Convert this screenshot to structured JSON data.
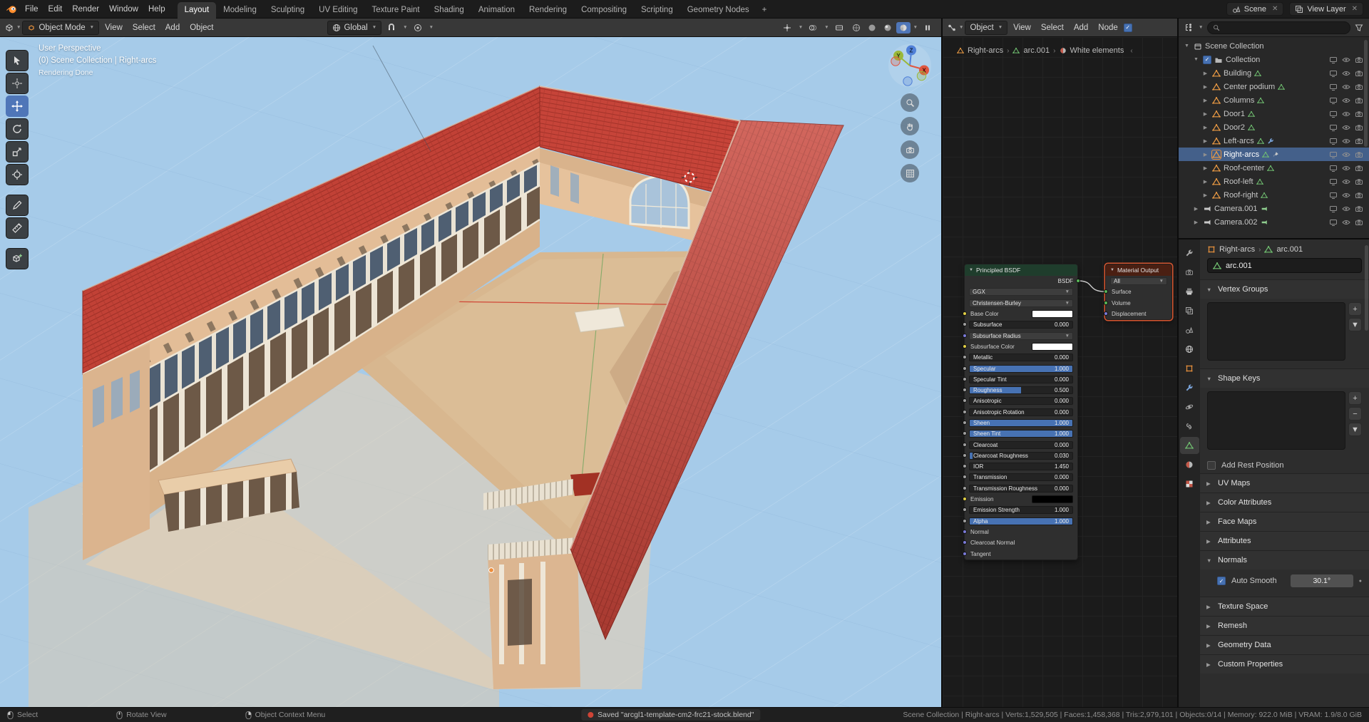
{
  "topbar": {
    "menus": [
      "File",
      "Edit",
      "Render",
      "Window",
      "Help"
    ],
    "workspaces": [
      "Layout",
      "Modeling",
      "Sculpting",
      "UV Editing",
      "Texture Paint",
      "Shading",
      "Animation",
      "Rendering",
      "Compositing",
      "Scripting",
      "Geometry Nodes"
    ],
    "active_workspace": "Layout",
    "add_workspace_label": "+",
    "scene_label": "Scene",
    "view_layer_label": "View Layer"
  },
  "viewport": {
    "header": {
      "mode": "Object Mode",
      "menus": [
        "View",
        "Select",
        "Add",
        "Object"
      ],
      "orientation": "Global"
    },
    "overlay": [
      "User Perspective",
      "(0) Scene Collection | Right-arcs",
      "Rendering Done"
    ],
    "gizmo_axes": [
      "X",
      "Y",
      "Z"
    ],
    "tools": [
      {
        "name": "select-box",
        "icon": "t_select",
        "active": false
      },
      {
        "name": "cursor",
        "icon": "t_cursor",
        "active": false
      },
      {
        "name": "move",
        "icon": "t_move",
        "active": true
      },
      {
        "name": "rotate",
        "icon": "t_rotate",
        "active": false
      },
      {
        "name": "scale",
        "icon": "t_scale",
        "active": false
      },
      {
        "name": "transform",
        "icon": "t_transform",
        "active": false
      },
      {
        "name": "annotate",
        "icon": "t_annotate",
        "active": false,
        "gap": true
      },
      {
        "name": "measure",
        "icon": "t_measure",
        "active": false
      },
      {
        "name": "add-cube",
        "icon": "t_addcube",
        "active": false,
        "gap": true
      }
    ]
  },
  "shader_editor": {
    "header": {
      "type": "Object",
      "menus": [
        "View",
        "Select",
        "Add",
        "Node"
      ]
    },
    "breadcrumb": [
      "Right-arcs",
      "arc.001",
      "White elements"
    ],
    "back_arrow": "‹",
    "principled": {
      "title": "Principled BSDF",
      "output_label": "BSDF",
      "dropdowns": [
        "GGX",
        "Christensen-Burley"
      ],
      "rows": [
        {
          "t": "color",
          "label": "Base Color",
          "swatch": "#ffffff",
          "socket": "yellow"
        },
        {
          "t": "slider",
          "label": "Subsurface",
          "value": "0.000",
          "fill": 0,
          "socket": "gray"
        },
        {
          "t": "dropdown",
          "label": "Subsurface Radius",
          "socket": "purple"
        },
        {
          "t": "color",
          "label": "Subsurface Color",
          "swatch": "#ffffff",
          "socket": "yellow"
        },
        {
          "t": "slider",
          "label": "Metallic",
          "value": "0.000",
          "fill": 0,
          "socket": "gray"
        },
        {
          "t": "slider",
          "label": "Specular",
          "value": "1.000",
          "fill": 1,
          "socket": "gray"
        },
        {
          "t": "slider",
          "label": "Specular Tint",
          "value": "0.000",
          "fill": 0,
          "socket": "gray"
        },
        {
          "t": "slider",
          "label": "Roughness",
          "value": "0.500",
          "fill": 0.5,
          "socket": "gray"
        },
        {
          "t": "slider",
          "label": "Anisotropic",
          "value": "0.000",
          "fill": 0,
          "socket": "gray"
        },
        {
          "t": "slider",
          "label": "Anisotropic Rotation",
          "value": "0.000",
          "fill": 0,
          "socket": "gray"
        },
        {
          "t": "slider",
          "label": "Sheen",
          "value": "1.000",
          "fill": 1,
          "socket": "gray"
        },
        {
          "t": "slider",
          "label": "Sheen Tint",
          "value": "1.000",
          "fill": 1,
          "socket": "gray"
        },
        {
          "t": "slider",
          "label": "Clearcoat",
          "value": "0.000",
          "fill": 0,
          "socket": "gray"
        },
        {
          "t": "slider",
          "label": "Clearcoat Roughness",
          "value": "0.030",
          "fill": 0.03,
          "socket": "gray"
        },
        {
          "t": "slider",
          "label": "IOR",
          "value": "1.450",
          "fill": 0,
          "socket": "gray"
        },
        {
          "t": "slider",
          "label": "Transmission",
          "value": "0.000",
          "fill": 0,
          "socket": "gray"
        },
        {
          "t": "slider",
          "label": "Transmission Roughness",
          "value": "0.000",
          "fill": 0,
          "socket": "gray"
        },
        {
          "t": "color",
          "label": "Emission",
          "swatch": "#000000",
          "socket": "yellow"
        },
        {
          "t": "slider",
          "label": "Emission Strength",
          "value": "1.000",
          "fill": 0,
          "socket": "gray"
        },
        {
          "t": "slider",
          "label": "Alpha",
          "value": "1.000",
          "fill": 1,
          "socket": "gray"
        },
        {
          "t": "plain",
          "label": "Normal",
          "socket": "purple"
        },
        {
          "t": "plain",
          "label": "Clearcoat Normal",
          "socket": "purple"
        },
        {
          "t": "plain",
          "label": "Tangent",
          "socket": "purple"
        }
      ]
    },
    "material_output": {
      "title": "Material Output",
      "dropdown": "All",
      "rows": [
        {
          "label": "Surface",
          "socket": "green"
        },
        {
          "label": "Volume",
          "socket": "green"
        },
        {
          "label": "Displacement",
          "socket": "purple"
        }
      ]
    }
  },
  "outliner": {
    "rows": [
      {
        "label": "Scene Collection",
        "icon": "sceneCol",
        "indent": 0,
        "expander": "open"
      },
      {
        "label": "Collection",
        "icon": "collection",
        "indent": 1,
        "expander": "open",
        "checkbox": true,
        "right": [
          "screen",
          "eye",
          "cam2"
        ]
      },
      {
        "label": "Building",
        "icon": "mesh",
        "indent": 2,
        "expander": "closed",
        "extras": [
          "meshData"
        ],
        "right": [
          "screen",
          "eye",
          "cam2"
        ]
      },
      {
        "label": "Center podium",
        "icon": "mesh",
        "indent": 2,
        "expander": "closed",
        "extras": [
          "meshData"
        ],
        "right": [
          "screen",
          "eye",
          "cam2"
        ]
      },
      {
        "label": "Columns",
        "icon": "mesh",
        "indent": 2,
        "expander": "closed",
        "extras": [
          "meshData"
        ],
        "right": [
          "screen",
          "eye",
          "cam2"
        ]
      },
      {
        "label": "Door1",
        "icon": "mesh",
        "indent": 2,
        "expander": "closed",
        "extras": [
          "meshData"
        ],
        "right": [
          "screen",
          "eye",
          "cam2"
        ]
      },
      {
        "label": "Door2",
        "icon": "mesh",
        "indent": 2,
        "expander": "closed",
        "extras": [
          "meshData"
        ],
        "right": [
          "screen",
          "eye",
          "cam2"
        ]
      },
      {
        "label": "Left-arcs",
        "icon": "mesh",
        "indent": 2,
        "expander": "closed",
        "extras": [
          "meshData",
          "wrench"
        ],
        "right": [
          "screen",
          "eye",
          "cam2"
        ]
      },
      {
        "label": "Right-arcs",
        "icon": "mesh",
        "indent": 2,
        "expander": "closed",
        "selected": true,
        "extras": [
          "meshData",
          "brush"
        ],
        "right": [
          "screen",
          "eye",
          "cam2"
        ]
      },
      {
        "label": "Roof-center",
        "icon": "mesh",
        "indent": 2,
        "expander": "closed",
        "extras": [
          "meshData"
        ],
        "right": [
          "screen",
          "eye",
          "cam2"
        ]
      },
      {
        "label": "Roof-left",
        "icon": "mesh",
        "indent": 2,
        "expander": "closed",
        "extras": [
          "meshData"
        ],
        "right": [
          "screen",
          "eye",
          "cam2"
        ]
      },
      {
        "label": "Roof-right",
        "icon": "mesh",
        "indent": 2,
        "expander": "closed",
        "extras": [
          "meshData"
        ],
        "right": [
          "screen",
          "eye",
          "cam2"
        ]
      },
      {
        "label": "Camera.001",
        "icon": "cameraObj",
        "indent": 1,
        "expander": "closed",
        "extras": [
          "camData"
        ],
        "right": [
          "screen",
          "eye",
          "cam2"
        ]
      },
      {
        "label": "Camera.002",
        "icon": "cameraObj",
        "indent": 1,
        "expander": "closed",
        "extras": [
          "camData"
        ],
        "right": [
          "screen",
          "eye",
          "cam2"
        ]
      }
    ]
  },
  "properties": {
    "tabs": [
      {
        "name": "tool"
      },
      {
        "name": "render"
      },
      {
        "name": "output"
      },
      {
        "name": "view-layer"
      },
      {
        "name": "scene"
      },
      {
        "name": "world"
      },
      {
        "name": "object"
      },
      {
        "name": "modifiers"
      },
      {
        "name": "physics"
      },
      {
        "name": "constraints"
      },
      {
        "name": "data",
        "active": true
      },
      {
        "name": "material"
      },
      {
        "name": "texture"
      }
    ],
    "breadcrumb": [
      "Right-arcs",
      "arc.001"
    ],
    "name_field": "arc.001",
    "auto_smooth": {
      "label": "Auto Smooth",
      "checked": true,
      "angle": "30.1°"
    },
    "sections": [
      {
        "title": "Vertex Groups",
        "expanded": true,
        "kind": "list",
        "buttons": [
          {
            "name": "add",
            "glyph": "+"
          },
          {
            "name": "specials",
            "glyph": "▼"
          }
        ]
      },
      {
        "title": "Shape Keys",
        "expanded": true,
        "kind": "list",
        "buttons": [
          {
            "name": "add",
            "glyph": "+"
          },
          {
            "name": "remove",
            "glyph": "−"
          },
          {
            "name": "specials",
            "glyph": "▼"
          }
        ]
      },
      {
        "kind": "checkbox",
        "label": "Add Rest Position",
        "checked": false
      },
      {
        "title": "UV Maps",
        "expanded": false
      },
      {
        "title": "Color Attributes",
        "expanded": false
      },
      {
        "title": "Face Maps",
        "expanded": false
      },
      {
        "title": "Attributes",
        "expanded": false
      },
      {
        "title": "Normals",
        "expanded": true,
        "kind": "normals"
      },
      {
        "title": "Texture Space",
        "expanded": false
      },
      {
        "title": "Remesh",
        "expanded": false
      },
      {
        "title": "Geometry Data",
        "expanded": false
      },
      {
        "title": "Custom Properties",
        "expanded": false
      }
    ]
  },
  "statusbar": {
    "hints": [
      {
        "button": "left",
        "label": "Select"
      },
      {
        "button": "middle",
        "label": "Rotate View"
      },
      {
        "button": "right",
        "label": "Object Context Menu"
      }
    ],
    "message": "Saved \"arcgl1-template-cm2-frc21-stock.blend\"",
    "stats": [
      "Scene Collection",
      "Right-arcs",
      "Verts:1,529,505",
      "Faces:1,458,368",
      "Tris:2,979,101",
      "Objects:0/14",
      "Memory: 922.0 MiB",
      "VRAM: 1.9/8.0 GiB"
    ]
  },
  "colors": {
    "accent": "#4772b3",
    "selection_orange": "#e8913c",
    "roof_red": "#c0392c",
    "viewport_sky": "#a6cbe9"
  }
}
